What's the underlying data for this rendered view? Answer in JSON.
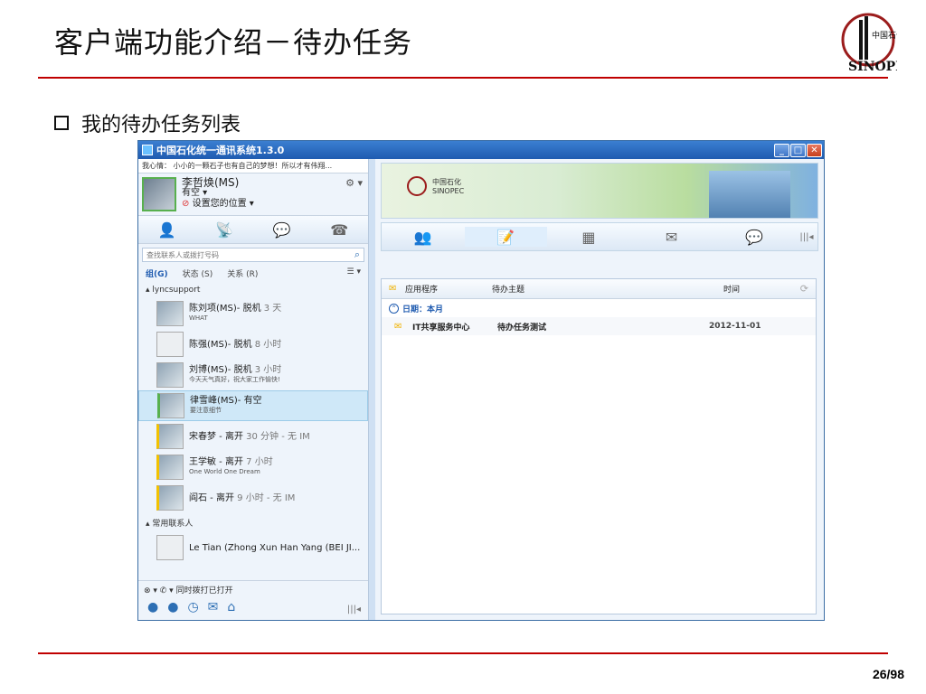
{
  "slide": {
    "title": "客户端功能介绍－待办任务",
    "bullet": "我的待办任务列表",
    "page_number": "26/98"
  },
  "window": {
    "title": "中国石化统一通讯系统1.3.0"
  },
  "left": {
    "mood": "我心情： 小小的一颗石子也有自己的梦想！所以才有伟翔...",
    "me": {
      "name": "李哲焕(MS)",
      "status": "有空 ▾",
      "location": "设置您的位置 ▾"
    },
    "search_placeholder": "查找联系人或拨打号码",
    "group_tabs": [
      "组(G)",
      "状态 (S)",
      "关系 (R)"
    ],
    "groups": [
      {
        "name": "▴ lyncsupport",
        "contacts": [
          {
            "name": "陈刘项(MS)- 脱机",
            "status": "3 天",
            "note": "WHAT"
          },
          {
            "name": "陈强(MS)- 脱机",
            "status": "8 小时",
            "note": ""
          },
          {
            "name": "刘博(MS)- 脱机",
            "status": "3 小时",
            "note": "今天天气真好，祝大家工作愉快!"
          },
          {
            "name": "律雪峰(MS)- 有空",
            "status": "",
            "note": "要注意细节"
          },
          {
            "name": "宋春梦 - 离开",
            "status": "30 分钟 - 无 IM",
            "note": ""
          },
          {
            "name": "王学敏 - 离开",
            "status": "7 小时",
            "note": "One World One Dream"
          },
          {
            "name": "阎石 - 离开",
            "status": "9 小时 - 无 IM",
            "note": ""
          }
        ]
      },
      {
        "name": "▴ 常用联系人",
        "contacts": [
          {
            "name": "Le Tian (Zhong Xun Han Yang (BEI JI...",
            "status": "",
            "note": ""
          }
        ]
      }
    ],
    "bottom_text": "同时拨打已打开"
  },
  "right": {
    "banner": {
      "brand_cn": "中国石化",
      "brand_en": "SINOPEC"
    },
    "table": {
      "headers": [
        "应用程序",
        "待办主题",
        "时间"
      ],
      "group_label": "日期：本月",
      "rows": [
        {
          "app": "IT共享服务中心",
          "subject": "待办任务测试",
          "time": "2012-11-01"
        }
      ]
    }
  }
}
